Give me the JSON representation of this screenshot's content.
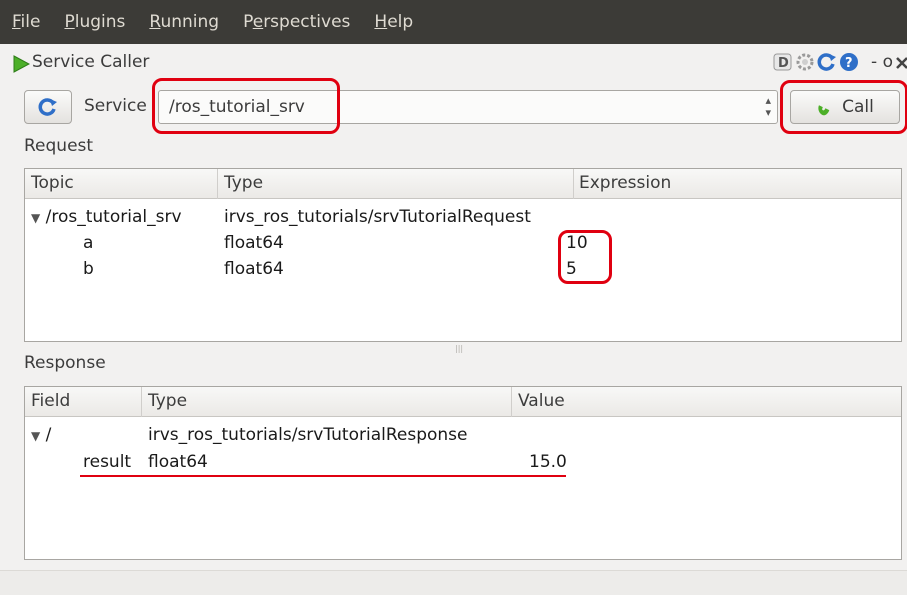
{
  "menubar": {
    "items": [
      {
        "mn": "F",
        "rest": "ile"
      },
      {
        "mn": "P",
        "rest": "lugins"
      },
      {
        "mn": "R",
        "rest": "unning"
      },
      {
        "pre": "P",
        "mn": "e",
        "rest": "rspectives"
      },
      {
        "mn": "H",
        "rest": "elp"
      }
    ]
  },
  "plugin": {
    "title": "Service Caller",
    "title_icon": "play-triangle-icon",
    "toolbar_icons": [
      "d-icon",
      "gear-icon",
      "reload-icon",
      "help-icon"
    ],
    "minimize": "- o"
  },
  "service_bar": {
    "label": "Service",
    "selected": "/ros_tutorial_srv",
    "call_label": "Call",
    "call_icon": "phone-icon",
    "refresh_icon": "refresh-icon"
  },
  "request": {
    "label": "Request",
    "headers": [
      "Topic",
      "Type",
      "Expression"
    ],
    "root": {
      "topic": "/ros_tutorial_srv",
      "type": "irvs_ros_tutorials/srvTutorialRequest"
    },
    "rows": [
      {
        "topic": "a",
        "type": "float64",
        "expression": "10"
      },
      {
        "topic": "b",
        "type": "float64",
        "expression": "5"
      }
    ]
  },
  "response": {
    "label": "Response",
    "headers": [
      "Field",
      "Type",
      "Value"
    ],
    "root": {
      "field": "/",
      "type": "irvs_ros_tutorials/srvTutorialResponse"
    },
    "rows": [
      {
        "field": "result",
        "type": "float64",
        "value": "15.0"
      }
    ]
  },
  "colors": {
    "menubar_bg": "#3c3b37",
    "annotation": "#e00010",
    "accent_green": "#4caf28",
    "refresh_blue": "#2f6fc8"
  }
}
